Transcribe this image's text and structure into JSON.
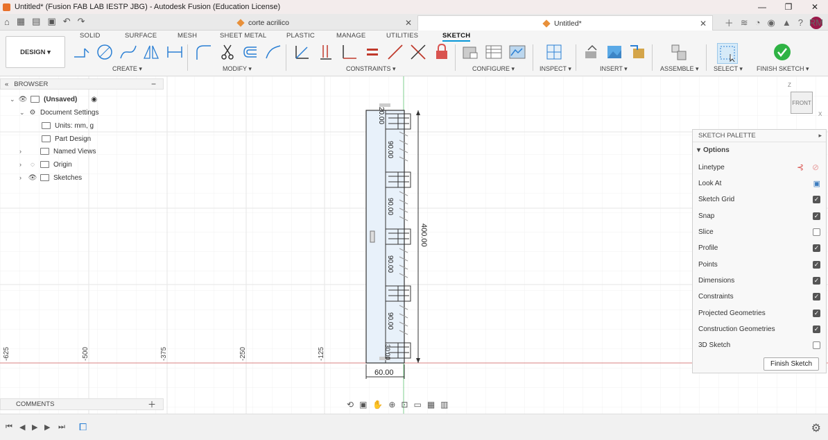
{
  "window": {
    "title": "Untitled* (Fusion FAB LAB IESTP JBG) - Autodesk Fusion (Education License)",
    "controls": [
      "—",
      "❐",
      "✕"
    ]
  },
  "doc_tabs": [
    {
      "label": "corte acrilico"
    },
    {
      "label": "Untitled*"
    }
  ],
  "user_initials": "RM",
  "ribbon": {
    "tabs": [
      "SOLID",
      "SURFACE",
      "MESH",
      "SHEET METAL",
      "PLASTIC",
      "MANAGE",
      "UTILITIES",
      "SKETCH"
    ],
    "active_tab": "SKETCH",
    "workspace": "DESIGN ▾",
    "groups": [
      "CREATE ▾",
      "MODIFY ▾",
      "CONSTRAINTS ▾",
      "CONFIGURE ▾",
      "INSPECT ▾",
      "INSERT ▾",
      "ASSEMBLE ▾",
      "SELECT ▾",
      "FINISH SKETCH ▾"
    ]
  },
  "browser": {
    "title": "BROWSER",
    "items": [
      {
        "label": "(Unsaved)"
      },
      {
        "label": "Document Settings"
      },
      {
        "label": "Units: mm, g"
      },
      {
        "label": "Part Design"
      },
      {
        "label": "Named Views"
      },
      {
        "label": "Origin"
      },
      {
        "label": "Sketches"
      }
    ]
  },
  "sketch_palette": {
    "title": "SKETCH PALETTE",
    "section": "Options",
    "rows": [
      {
        "label": "Linetype",
        "type": "icons"
      },
      {
        "label": "Look At",
        "type": "icon"
      },
      {
        "label": "Sketch Grid",
        "checked": true
      },
      {
        "label": "Snap",
        "checked": true
      },
      {
        "label": "Slice",
        "checked": false
      },
      {
        "label": "Profile",
        "checked": true
      },
      {
        "label": "Points",
        "checked": true
      },
      {
        "label": "Dimensions",
        "checked": true
      },
      {
        "label": "Constraints",
        "checked": true
      },
      {
        "label": "Projected Geometries",
        "checked": true
      },
      {
        "label": "Construction Geometries",
        "checked": true
      },
      {
        "label": "3D Sketch",
        "checked": false
      }
    ],
    "finish_button": "Finish Sketch"
  },
  "canvas": {
    "axis_ticks": [
      "-625",
      "-500",
      "-375",
      "-250",
      "-125"
    ],
    "dimensions": {
      "top": "20.00",
      "segments": [
        "90.00",
        "90.00",
        "90.00",
        "90.00"
      ],
      "total_height": "400.00",
      "width": "60.00",
      "bottom": "30.00"
    },
    "viewcube": {
      "face": "FRONT",
      "z": "Z",
      "x": "X"
    }
  },
  "comments": {
    "title": "COMMENTS"
  },
  "colors": {
    "accent": "#0696d7",
    "finish_green": "#2fb344",
    "avatar": "#9b1a4a",
    "x_axis": "#d98080",
    "y_axis": "#7fcf8f"
  }
}
